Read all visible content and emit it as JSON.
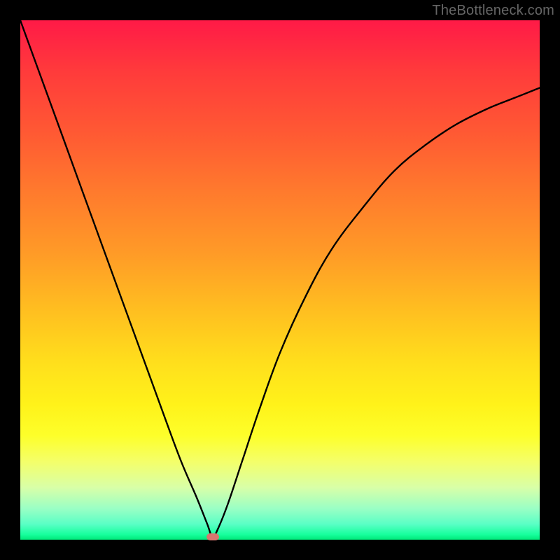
{
  "watermark": "TheBottleneck.com",
  "colors": {
    "frame": "#000000",
    "curve": "#000000",
    "marker": "#d8766f"
  },
  "chart_data": {
    "type": "line",
    "title": "",
    "xlabel": "",
    "ylabel": "",
    "xlim": [
      0,
      100
    ],
    "ylim": [
      0,
      100
    ],
    "grid": false,
    "legend": false,
    "note": "V-shaped bottleneck curve. Background is a vertical red→green gradient (high bottleneck at top, low at bottom). The curve reaches its minimum near x≈37, y≈0.5. Values are estimated from pixel positions; the source image has no numeric axis ticks.",
    "series": [
      {
        "name": "bottleneck-curve",
        "x": [
          0,
          4,
          8,
          12,
          16,
          20,
          24,
          28,
          31,
          34,
          36,
          37,
          38,
          40,
          43,
          46,
          50,
          55,
          60,
          66,
          72,
          78,
          84,
          90,
          95,
          100
        ],
        "y": [
          100,
          89,
          78,
          67,
          56,
          45,
          34,
          23,
          15,
          8,
          3,
          0.5,
          2,
          7,
          16,
          25,
          36,
          47,
          56,
          64,
          71,
          76,
          80,
          83,
          85,
          87
        ]
      }
    ],
    "marker": {
      "x": 37,
      "y": 0.5
    },
    "gradient_stops": [
      {
        "pos": 0,
        "color": "#ff1a47"
      },
      {
        "pos": 50,
        "color": "#ffbf20"
      },
      {
        "pos": 80,
        "color": "#fdff2a"
      },
      {
        "pos": 100,
        "color": "#00e87a"
      }
    ]
  }
}
